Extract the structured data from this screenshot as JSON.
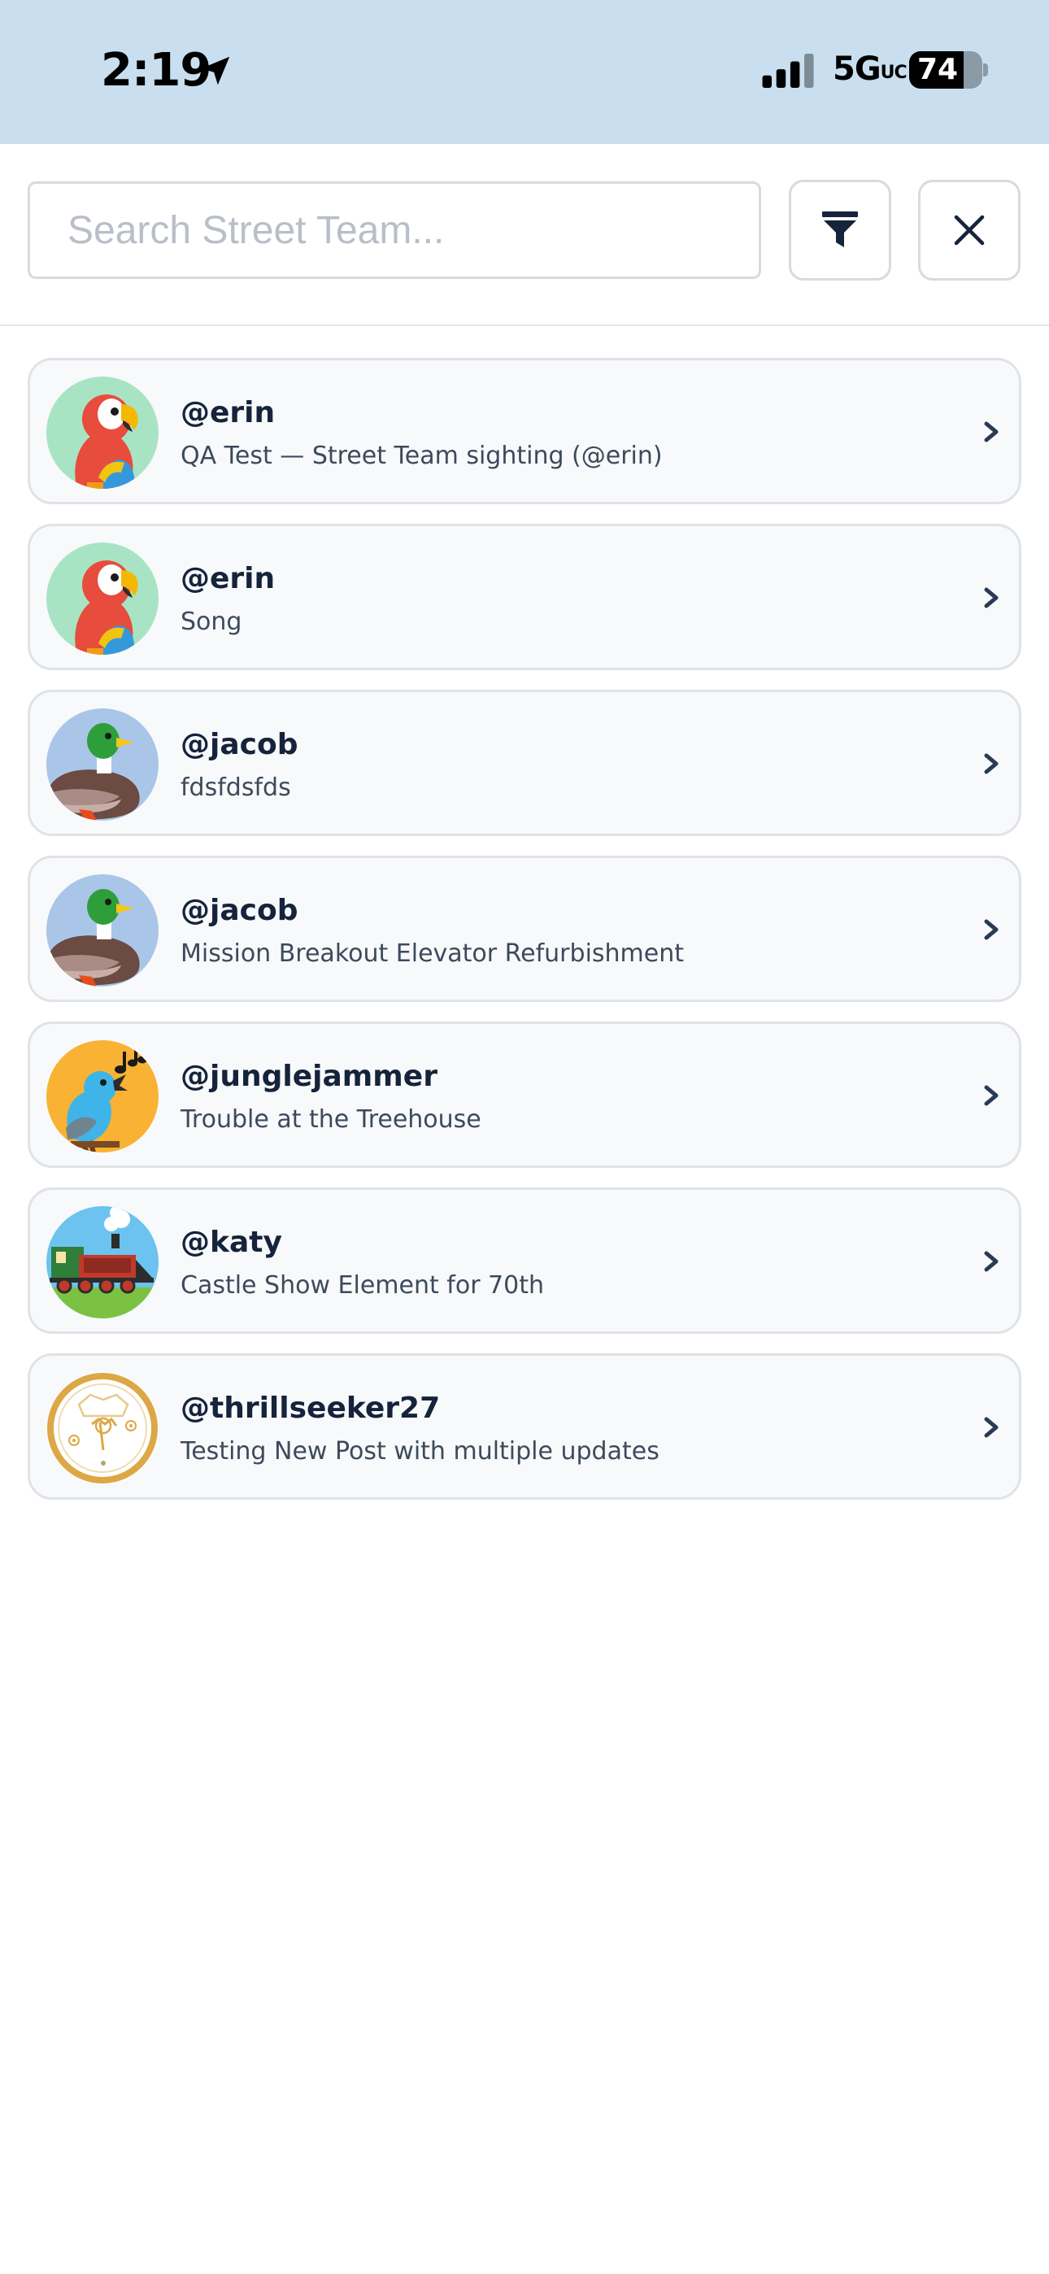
{
  "status_bar": {
    "time": "2:19",
    "network": "5G",
    "network_suffix": "UC",
    "battery": "74",
    "battery_level": 0.74
  },
  "search": {
    "placeholder": "Search Street Team...",
    "value": ""
  },
  "posts": [
    {
      "handle": "@erin",
      "title": "QA Test — Street Team sighting (@erin)",
      "avatar": "parrot"
    },
    {
      "handle": "@erin",
      "title": "Song",
      "avatar": "parrot"
    },
    {
      "handle": "@jacob",
      "title": "fdsfdsfds",
      "avatar": "duck"
    },
    {
      "handle": "@jacob",
      "title": "Mission Breakout Elevator Refurbishment",
      "avatar": "duck"
    },
    {
      "handle": "@junglejammer",
      "title": "Trouble at the Treehouse",
      "avatar": "singing-bird"
    },
    {
      "handle": "@katy",
      "title": "Castle Show Element for 70th",
      "avatar": "train"
    },
    {
      "handle": "@thrillseeker27",
      "title": "Testing New Post with multiple updates",
      "avatar": "sun-badge"
    }
  ],
  "colors": {
    "status_bar_bg": "#c9dfef",
    "card_bg": "#f8f9fb",
    "card_border": "#dfe3e8",
    "text_primary": "#15233b",
    "text_secondary": "#3d4a5c"
  }
}
